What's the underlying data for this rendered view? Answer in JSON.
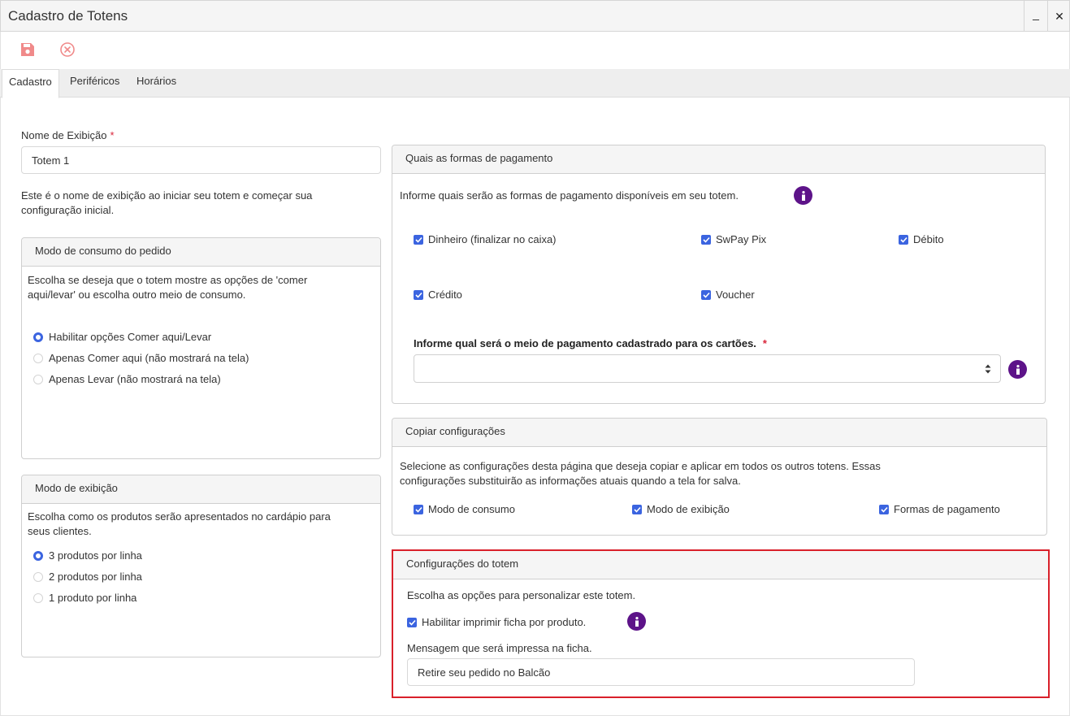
{
  "window": {
    "title": "Cadastro de Totens",
    "minimize_label": "_",
    "close_label": "✕"
  },
  "toolbar": {
    "save_icon": "save-icon",
    "cancel_icon": "cancel-icon",
    "accent_color": "#f08a8a"
  },
  "tabs": [
    "Cadastro",
    "Periféricos",
    "Horários"
  ],
  "nome": {
    "label": "Nome de Exibição",
    "required_mark": "*",
    "value": "Totem 1",
    "help_line1": "Este é o nome de exibição ao iniciar seu totem e começar sua",
    "help_line2": "configuração inicial."
  },
  "consumo": {
    "title": "Modo de consumo do pedido",
    "desc_line1": "Escolha se deseja que o totem mostre as opções de 'comer",
    "desc_line2": "aqui/levar' ou escolha outro meio de consumo.",
    "options": [
      "Habilitar opções Comer aqui/Levar",
      "Apenas Comer aqui (não mostrará na tela)",
      "Apenas Levar (não mostrará na tela)"
    ],
    "selected_index": 0
  },
  "exibicao": {
    "title": "Modo de exibição",
    "desc_line1": "Escolha como os produtos serão apresentados no cardápio para",
    "desc_line2": "seus clientes.",
    "options": [
      "3 produtos por linha",
      "2 produtos por linha",
      "1 produto por linha"
    ],
    "selected_index": 0
  },
  "pagamento": {
    "title": "Quais as formas de pagamento",
    "desc": "Informe quais serão as formas de pagamento disponíveis em seu totem.",
    "options": [
      "Dinheiro (finalizar no caixa)",
      "SwPay Pix",
      "Débito",
      "Crédito",
      "Voucher"
    ],
    "meio_label": "Informe qual será o meio de pagamento cadastrado para os cartões.",
    "required_mark": "*",
    "meio_value": ""
  },
  "copiar": {
    "title": "Copiar configurações",
    "desc_line1": "Selecione as configurações desta página que deseja copiar e aplicar em todos os outros totens. Essas",
    "desc_line2": "configurações substituirão as informações atuais quando a tela for salva.",
    "options": [
      "Modo de consumo",
      "Modo de exibição",
      "Formas de pagamento"
    ]
  },
  "totem": {
    "title": "Configurações do totem",
    "desc": "Escolha as opções para personalizar este totem.",
    "imprimir_label": "Habilitar imprimir ficha por produto.",
    "mensagem_label": "Mensagem que será impressa na ficha.",
    "mensagem_value": "Retire seu pedido no Balcão",
    "highlight_color": "#d9202a"
  },
  "colors": {
    "accent": "#3b64e0",
    "info": "#5d1389",
    "required": "#d9263b"
  }
}
